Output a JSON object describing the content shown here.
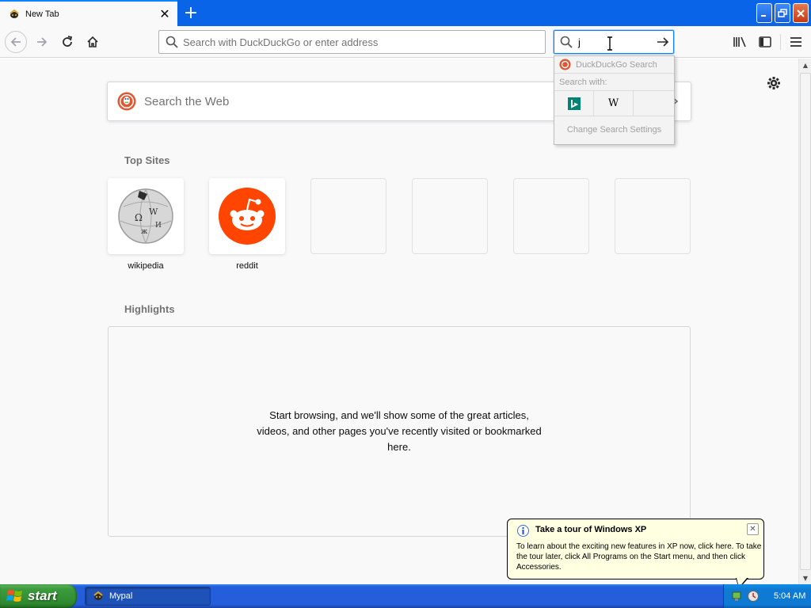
{
  "browser": {
    "tab": {
      "title": "New Tab",
      "close": "✕"
    },
    "new_tab": "+",
    "urlbar": {
      "placeholder": "Search with DuckDuckGo or enter address",
      "value": ""
    },
    "searchbar": {
      "value": "j"
    }
  },
  "search_popup": {
    "engine": "DuckDuckGo Search",
    "search_with": "Search with:",
    "engines": [
      "Bing",
      "Wikipedia"
    ],
    "settings": "Change Search Settings"
  },
  "newtab": {
    "search_placeholder": "Search the Web",
    "top_sites_title": "Top Sites",
    "top_sites": [
      {
        "label": "wikipedia",
        "icon": "wikipedia-icon"
      },
      {
        "label": "reddit",
        "icon": "reddit-icon"
      },
      {
        "label": ""
      },
      {
        "label": ""
      },
      {
        "label": ""
      },
      {
        "label": ""
      }
    ],
    "highlights_title": "Highlights",
    "highlights_message": "Start browsing, and we'll show some of the great articles, videos, and other pages you've recently visited or bookmarked here."
  },
  "balloon": {
    "title": "Take a tour of Windows XP",
    "close": "✕",
    "body": "To learn about the exciting new features in XP now, click here. To take the tour later, click All Programs on the Start menu, and then click Accessories."
  },
  "taskbar": {
    "start": "start",
    "task_label": "Mypal",
    "clock": "5:04 AM"
  },
  "colors": {
    "accent": "#0a84ff",
    "titlebar": "#0a64e8",
    "reddit": "#ff4500",
    "taskbar": "#245edb",
    "start_green": "#3c9c3c"
  }
}
